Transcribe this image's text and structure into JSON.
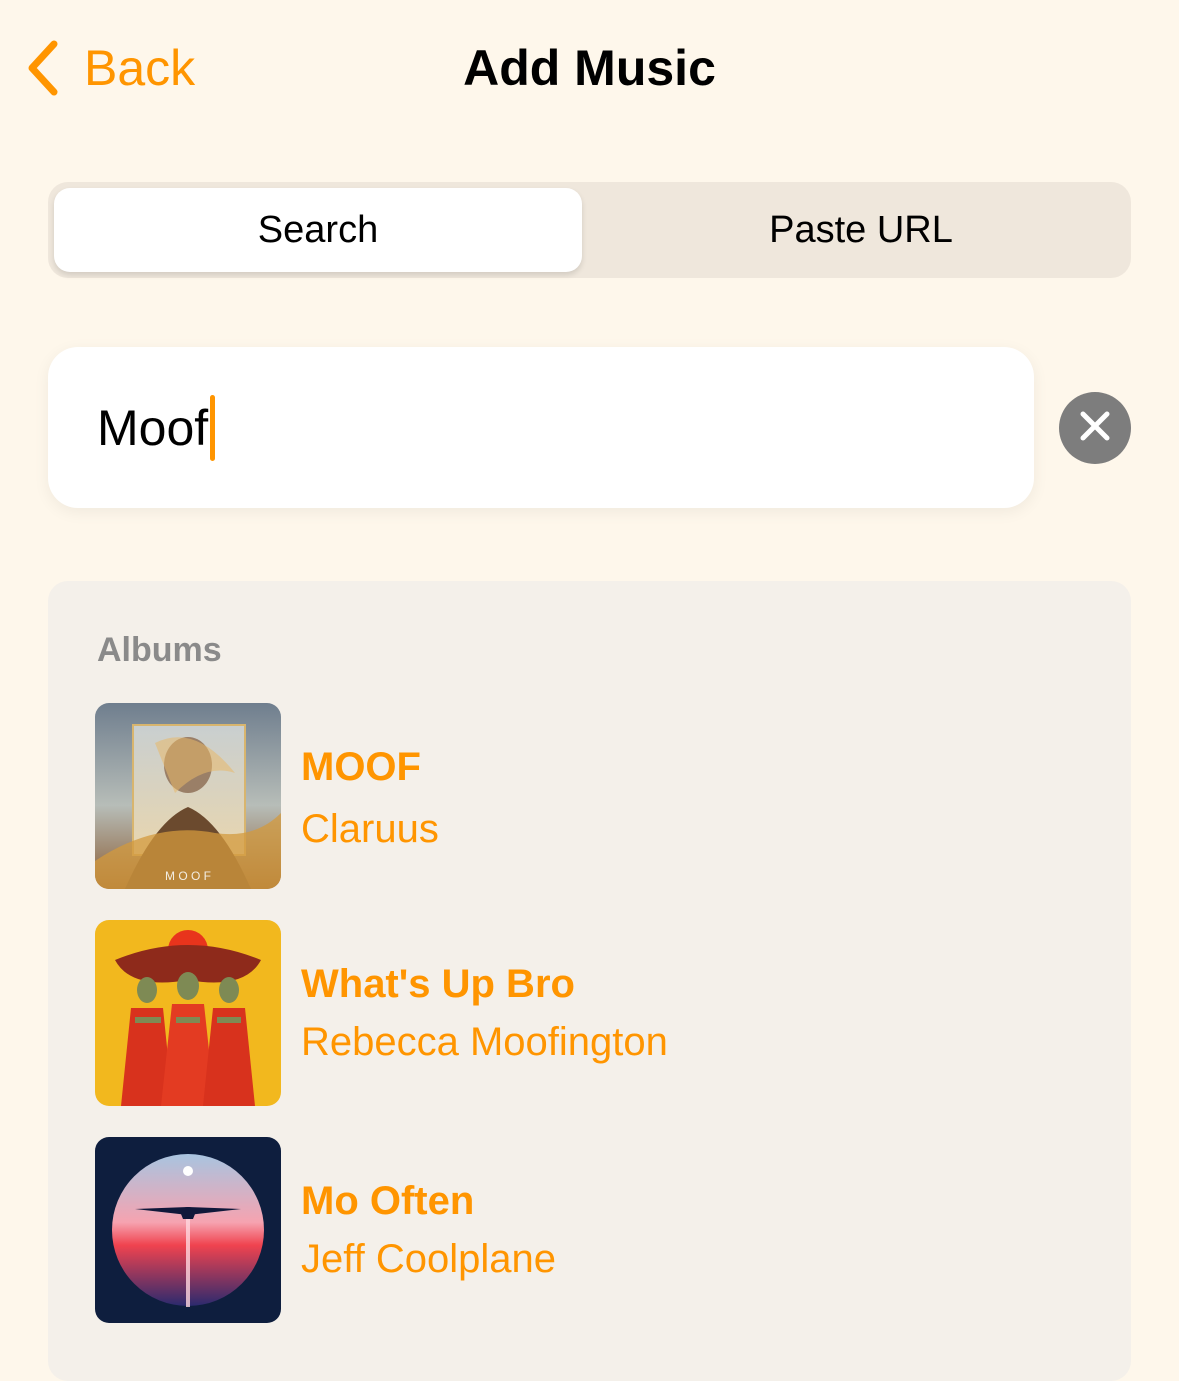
{
  "colors": {
    "accent": "#FF9500",
    "background": "#FEF7EB",
    "segment_track": "#EFE7DC",
    "results_panel": "#F4F0EA",
    "clear_button": "#7D7D7D"
  },
  "nav": {
    "back_label": "Back",
    "back_icon": "chevron-left-icon",
    "title": "Add Music"
  },
  "segmented": {
    "tabs": [
      {
        "label": "Search",
        "selected": true
      },
      {
        "label": "Paste URL",
        "selected": false
      }
    ]
  },
  "search": {
    "value": "Moof",
    "clear_icon": "clear-x-icon"
  },
  "results": {
    "section_title": "Albums",
    "albums": [
      {
        "title": "MOOF",
        "artist": "Claruus",
        "art_text": "M O O F"
      },
      {
        "title": "What's Up Bro",
        "artist": "Rebecca Moofington"
      },
      {
        "title": "Mo Often",
        "artist": "Jeff Coolplane"
      }
    ]
  }
}
